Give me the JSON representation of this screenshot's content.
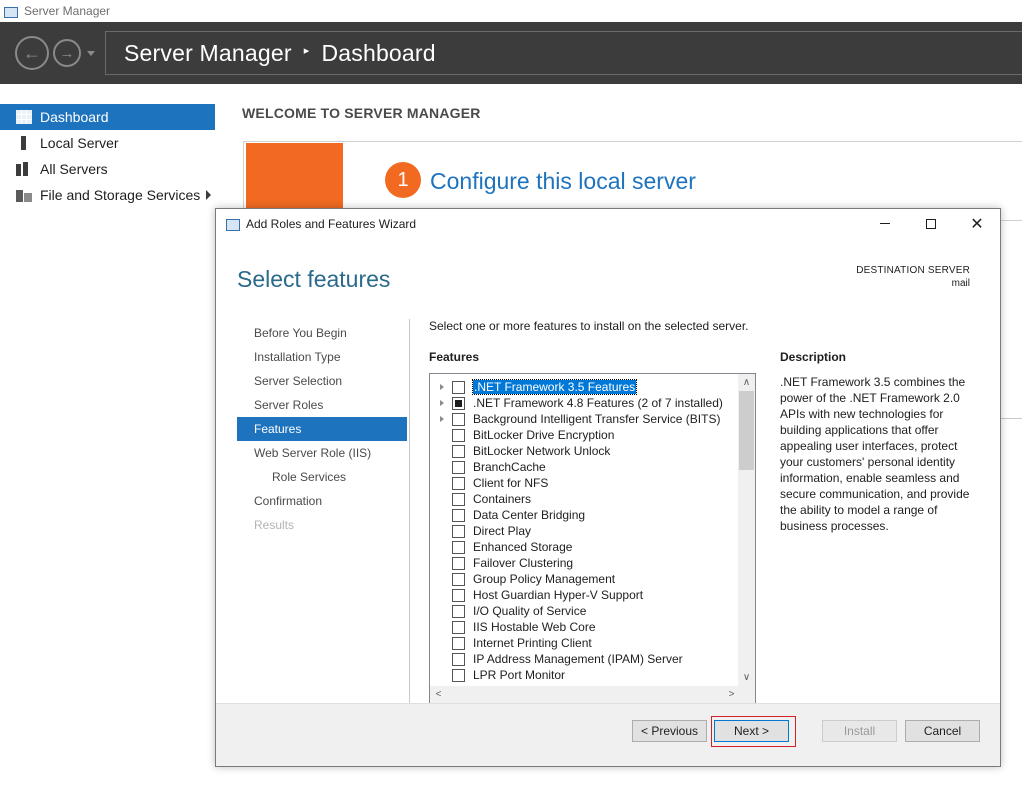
{
  "app": {
    "window_title": "Server Manager"
  },
  "header": {
    "crumb_root": "Server Manager",
    "crumb_separator": "▸",
    "crumb_current": "Dashboard"
  },
  "sidebar": {
    "items": [
      {
        "label": "Dashboard",
        "icon": "dashboard-grid-icon",
        "active": true
      },
      {
        "label": "Local Server",
        "icon": "server-icon"
      },
      {
        "label": "All Servers",
        "icon": "servers-icon"
      },
      {
        "label": "File and Storage Services",
        "icon": "storage-icon",
        "has_submenu": true
      }
    ]
  },
  "main": {
    "welcome_title": "WELCOME TO SERVER MANAGER",
    "step_number": "1",
    "configure_link": "Configure this local server"
  },
  "wizard": {
    "title": "Add Roles and Features Wizard",
    "heading": "Select features",
    "destination_label": "DESTINATION SERVER",
    "destination_name": "mail",
    "steps": [
      {
        "label": "Before You Begin",
        "state": "normal"
      },
      {
        "label": "Installation Type",
        "state": "normal"
      },
      {
        "label": "Server Selection",
        "state": "normal"
      },
      {
        "label": "Server Roles",
        "state": "normal"
      },
      {
        "label": "Features",
        "state": "active"
      },
      {
        "label": "Web Server Role (IIS)",
        "state": "normal"
      },
      {
        "label": "Role Services",
        "state": "sub"
      },
      {
        "label": "Confirmation",
        "state": "normal"
      },
      {
        "label": "Results",
        "state": "disabled"
      }
    ],
    "instruction": "Select one or more features to install on the selected server.",
    "features_header": "Features",
    "description_header": "Description",
    "description_text": ".NET Framework 3.5 combines the power of the .NET Framework 2.0 APIs with new technologies for building applications that offer appealing user interfaces, protect your customers' personal identity information, enable seamless and secure communication, and provide the ability to model a range of business processes.",
    "features": [
      {
        "label": ".NET Framework 3.5 Features",
        "expandable": true,
        "check": "unchecked",
        "selected": true
      },
      {
        "label": ".NET Framework 4.8 Features (2 of 7 installed)",
        "expandable": true,
        "check": "partial",
        "selected": false
      },
      {
        "label": "Background Intelligent Transfer Service (BITS)",
        "expandable": true,
        "check": "unchecked",
        "selected": false
      },
      {
        "label": "BitLocker Drive Encryption",
        "expandable": false,
        "check": "unchecked",
        "selected": false
      },
      {
        "label": "BitLocker Network Unlock",
        "expandable": false,
        "check": "unchecked",
        "selected": false
      },
      {
        "label": "BranchCache",
        "expandable": false,
        "check": "unchecked",
        "selected": false
      },
      {
        "label": "Client for NFS",
        "expandable": false,
        "check": "unchecked",
        "selected": false
      },
      {
        "label": "Containers",
        "expandable": false,
        "check": "unchecked",
        "selected": false
      },
      {
        "label": "Data Center Bridging",
        "expandable": false,
        "check": "unchecked",
        "selected": false
      },
      {
        "label": "Direct Play",
        "expandable": false,
        "check": "unchecked",
        "selected": false
      },
      {
        "label": "Enhanced Storage",
        "expandable": false,
        "check": "unchecked",
        "selected": false
      },
      {
        "label": "Failover Clustering",
        "expandable": false,
        "check": "unchecked",
        "selected": false
      },
      {
        "label": "Group Policy Management",
        "expandable": false,
        "check": "unchecked",
        "selected": false
      },
      {
        "label": "Host Guardian Hyper-V Support",
        "expandable": false,
        "check": "unchecked",
        "selected": false
      },
      {
        "label": "I/O Quality of Service",
        "expandable": false,
        "check": "unchecked",
        "selected": false
      },
      {
        "label": "IIS Hostable Web Core",
        "expandable": false,
        "check": "unchecked",
        "selected": false
      },
      {
        "label": "Internet Printing Client",
        "expandable": false,
        "check": "unchecked",
        "selected": false
      },
      {
        "label": "IP Address Management (IPAM) Server",
        "expandable": false,
        "check": "unchecked",
        "selected": false
      },
      {
        "label": "LPR Port Monitor",
        "expandable": false,
        "check": "unchecked",
        "selected": false
      }
    ],
    "buttons": {
      "previous": "< Previous",
      "next": "Next >",
      "install": "Install",
      "cancel": "Cancel"
    }
  },
  "colors": {
    "header_bg": "#3c3c3c",
    "accent_blue": "#1e73be",
    "orange": "#f26a21",
    "highlight_red": "#d0202a"
  }
}
